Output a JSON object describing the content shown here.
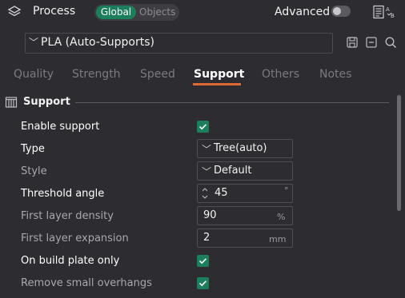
{
  "header": {
    "title": "Process",
    "scope_global": "Global",
    "scope_objects": "Objects",
    "advanced_label": "Advanced",
    "advanced_on": false
  },
  "preset": {
    "name": "PLA (Auto-Supports)"
  },
  "tabs": [
    {
      "label": "Quality",
      "active": false
    },
    {
      "label": "Strength",
      "active": false
    },
    {
      "label": "Speed",
      "active": false
    },
    {
      "label": "Support",
      "active": true
    },
    {
      "label": "Others",
      "active": false
    },
    {
      "label": "Notes",
      "active": false
    }
  ],
  "section": {
    "title": "Support"
  },
  "rows": {
    "enable_support": {
      "label": "Enable support",
      "checked": true
    },
    "type": {
      "label": "Type",
      "value": "Tree(auto)"
    },
    "style": {
      "label": "Style",
      "value": "Default"
    },
    "threshold_angle": {
      "label": "Threshold angle",
      "value": "45",
      "unit": "°"
    },
    "first_layer_density": {
      "label": "First layer density",
      "value": "90",
      "unit": "%"
    },
    "first_layer_expansion": {
      "label": "First layer expansion",
      "value": "2",
      "unit": "mm"
    },
    "on_build_plate_only": {
      "label": "On build plate only",
      "checked": true
    },
    "remove_small_overhangs": {
      "label": "Remove small overhangs",
      "checked": true
    }
  },
  "colors": {
    "background": "#2d2d31",
    "accent_green": "#1b7e5d",
    "tab_underline": "#e06a35"
  }
}
